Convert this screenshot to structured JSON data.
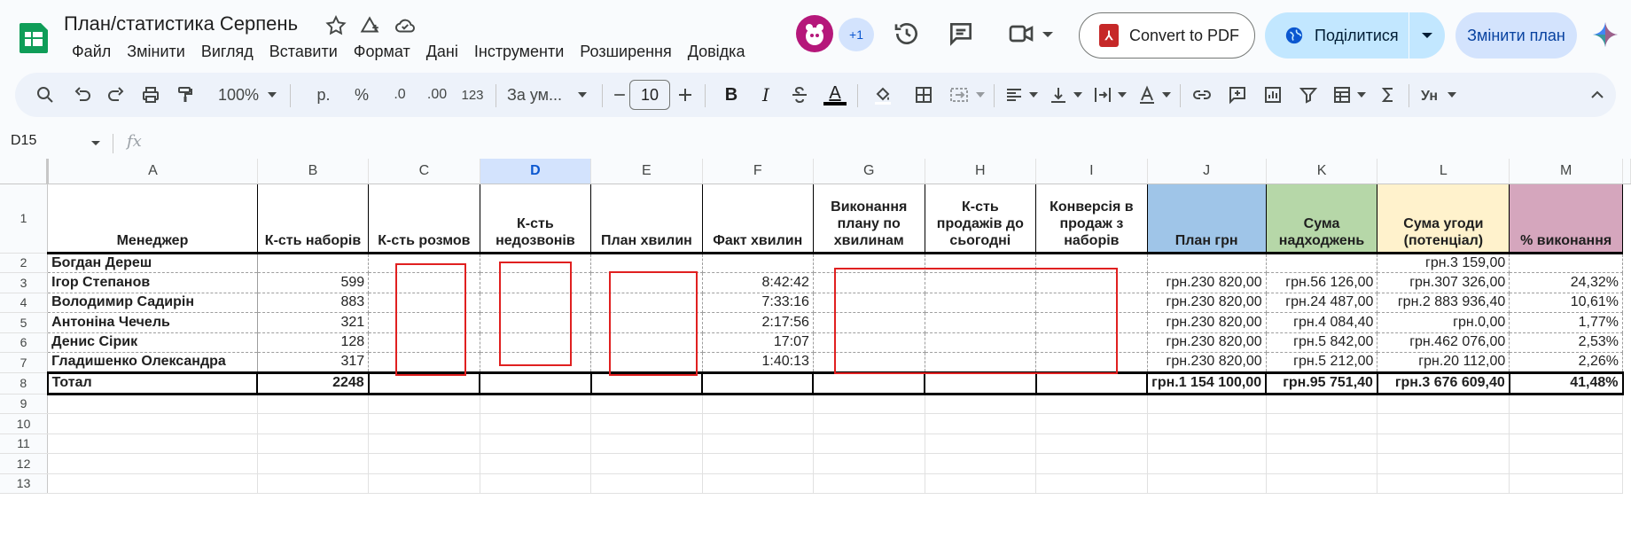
{
  "title": {
    "doc_name": "План/статистика Серпень",
    "menu": [
      "Файл",
      "Змінити",
      "Вигляд",
      "Вставити",
      "Формат",
      "Дані",
      "Інструменти",
      "Розширення",
      "Довідка"
    ],
    "collaborators_more": "+1",
    "convert_pdf_label": "Convert to PDF",
    "share_label": "Поділитися",
    "change_plan_label": "Змінити план"
  },
  "toolbar": {
    "zoom": "100%",
    "currency": "р.",
    "percent": "%",
    "dec_decrease": ".0",
    "dec_increase": ".00",
    "format_123": "123",
    "font_name": "За ум...",
    "font_size": "10",
    "bold": "B",
    "italic": "I",
    "text_color": "A"
  },
  "formula_bar": {
    "cell_ref": "D15",
    "fx": "fx",
    "value": ""
  },
  "sheet": {
    "selected_column": "D",
    "columns": [
      "A",
      "B",
      "C",
      "D",
      "E",
      "F",
      "G",
      "H",
      "I",
      "J",
      "K",
      "L",
      "M"
    ],
    "header_row": [
      "Менеджер",
      "К-сть наборів",
      "К-сть розмов",
      "К-сть недозвонів",
      "План хвилин",
      "Факт хвилин",
      "Виконання плану по хвилинам",
      "К-сть продажів до сьогодні",
      "Конверсія в продаж з наборів",
      "План грн",
      "Сума надходжень",
      "Сума угоди (потенціал)",
      "% виконання"
    ],
    "rows": [
      [
        "Богдан Дереш",
        "",
        "",
        "",
        "",
        "",
        "",
        "",
        "",
        "",
        "",
        "грн.3 159,00",
        ""
      ],
      [
        "Ігор Степанов",
        "599",
        "",
        "",
        "",
        "8:42:42",
        "",
        "",
        "",
        "грн.230 820,00",
        "грн.56 126,00",
        "грн.307 326,00",
        "24,32%"
      ],
      [
        "Володимир Садирін",
        "883",
        "",
        "",
        "",
        "7:33:16",
        "",
        "",
        "",
        "грн.230 820,00",
        "грн.24 487,00",
        "грн.2 883 936,40",
        "10,61%"
      ],
      [
        "Антоніна Чечель",
        "321",
        "",
        "",
        "",
        "2:17:56",
        "",
        "",
        "",
        "грн.230 820,00",
        "грн.4 084,40",
        "грн.0,00",
        "1,77%"
      ],
      [
        "Денис Сірик",
        "128",
        "",
        "",
        "",
        "17:07",
        "",
        "",
        "",
        "грн.230 820,00",
        "грн.5 842,00",
        "грн.462 076,00",
        "2,53%"
      ],
      [
        "Гладишенко Олександра",
        "317",
        "",
        "",
        "",
        "1:40:13",
        "",
        "",
        "",
        "грн.230 820,00",
        "грн.5 212,00",
        "грн.20 112,00",
        "2,26%"
      ],
      [
        "Тотал",
        "2248",
        "",
        "",
        "",
        "",
        "",
        "",
        "",
        "грн.1 154 100,00",
        "грн.95 751,40",
        "грн.3 676 609,40",
        "41,48%"
      ]
    ],
    "row_numbers": [
      "1",
      "2",
      "3",
      "4",
      "5",
      "6",
      "7",
      "8",
      "9",
      "10",
      "11",
      "12",
      "13"
    ]
  },
  "colors": {
    "plan_grn_bg": "#9fc5e8",
    "receipts_bg": "#b6d7a8",
    "potential_bg": "#fff2cc",
    "completion_bg": "#d5a6bd",
    "annotation_red": "#e02020"
  }
}
